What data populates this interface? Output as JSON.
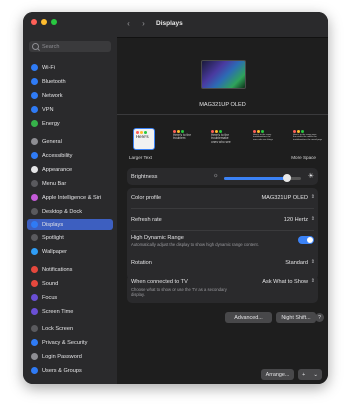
{
  "window": {
    "title": "Displays"
  },
  "search": {
    "placeholder": "Search"
  },
  "sidebar": {
    "items": [
      {
        "label": "Wi-Fi",
        "icon": "wifi-icon",
        "color": "#2f7bf5"
      },
      {
        "label": "Bluetooth",
        "icon": "bluetooth-icon",
        "color": "#2f7bf5"
      },
      {
        "label": "Network",
        "icon": "network-icon",
        "color": "#2f7bf5"
      },
      {
        "label": "VPN",
        "icon": "vpn-icon",
        "color": "#2f7bf5"
      },
      {
        "label": "Energy",
        "icon": "energy-icon",
        "color": "#36b24a"
      },
      {
        "label": "General",
        "icon": "gear-icon",
        "color": "#8e8e93"
      },
      {
        "label": "Accessibility",
        "icon": "accessibility-icon",
        "color": "#2f7bf5"
      },
      {
        "label": "Appearance",
        "icon": "appearance-icon",
        "color": "#e5e5e7"
      },
      {
        "label": "Menu Bar",
        "icon": "menu-bar-icon",
        "color": "#5a5a5e"
      },
      {
        "label": "Apple Intelligence & Siri",
        "icon": "siri-icon",
        "color": "#c45bd8"
      },
      {
        "label": "Desktop & Dock",
        "icon": "dock-icon",
        "color": "#5a5a5e"
      },
      {
        "label": "Displays",
        "icon": "display-icon",
        "color": "#2f7bf5"
      },
      {
        "label": "Spotlight",
        "icon": "spotlight-icon",
        "color": "#5a5a5e"
      },
      {
        "label": "Wallpaper",
        "icon": "wallpaper-icon",
        "color": "#2f9df5"
      },
      {
        "label": "Notifications",
        "icon": "bell-icon",
        "color": "#e5483d"
      },
      {
        "label": "Sound",
        "icon": "sound-icon",
        "color": "#e5483d"
      },
      {
        "label": "Focus",
        "icon": "focus-icon",
        "color": "#6a4fd4"
      },
      {
        "label": "Screen Time",
        "icon": "hourglass-icon",
        "color": "#6a4fd4"
      },
      {
        "label": "Lock Screen",
        "icon": "lock-icon",
        "color": "#5a5a5e"
      },
      {
        "label": "Privacy & Security",
        "icon": "hand-icon",
        "color": "#2f7bf5"
      },
      {
        "label": "Login Password",
        "icon": "password-icon",
        "color": "#8e8e93"
      },
      {
        "label": "Users & Groups",
        "icon": "users-icon",
        "color": "#2f7bf5"
      },
      {
        "label": "Internet Accounts",
        "icon": "at-icon",
        "color": "#2f7bf5"
      }
    ]
  },
  "monitor": {
    "name": "MAG321UP OLED"
  },
  "resolution": {
    "options": [
      {
        "lines": [
          "Here's"
        ]
      },
      {
        "lines": [
          "Here's to the",
          "troublem"
        ]
      },
      {
        "lines": [
          "Here's to the",
          "troublemake",
          "ones who see"
        ]
      },
      {
        "lines": [
          "Here's to the crazy",
          "troublemakers the",
          "ones who see things"
        ]
      },
      {
        "lines": [
          "Here's to the crazy ones",
          "the misfits the rebels the",
          "troublemakers the round pegs"
        ]
      }
    ],
    "left_label": "Larger Text",
    "right_label": "More Space",
    "selected_index": 0
  },
  "brightness": {
    "label": "Brightness",
    "level": 0.82
  },
  "color_profile": {
    "label": "Color profile",
    "value": "MAG321UP OLED"
  },
  "refresh_rate": {
    "label": "Refresh rate",
    "value": "120 Hertz"
  },
  "hdr": {
    "label": "High Dynamic Range",
    "desc": "Automatically adjust the display to show high dynamic range content.",
    "enabled": true
  },
  "rotation": {
    "label": "Rotation",
    "value": "Standard"
  },
  "tv": {
    "label": "When connected to TV",
    "desc": "Choose what to show or use the TV as a secondary display.",
    "value": "Ask What to Show"
  },
  "buttons": {
    "advanced": "Advanced...",
    "night_shift": "Night Shift...",
    "help": "?",
    "arrange": "Arrange...",
    "add": "+",
    "more": "⌄"
  },
  "colors": {
    "accent": "#3b82f6",
    "selected": "#3d5fc0",
    "window_bg": "#1e1e1e"
  }
}
